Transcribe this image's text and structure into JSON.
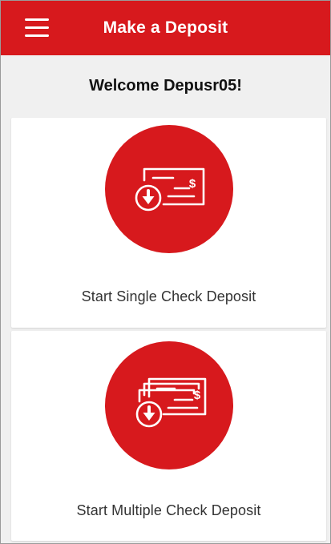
{
  "header": {
    "title": "Make a Deposit",
    "menu_icon": "hamburger-menu-icon"
  },
  "welcome": {
    "text": "Welcome Depusr05!"
  },
  "options": [
    {
      "label": "Start Single Check Deposit",
      "icon": "single-check-deposit-icon"
    },
    {
      "label": "Start Multiple Check Deposit",
      "icon": "multiple-check-deposit-icon"
    }
  ],
  "colors": {
    "brand_red": "#d7191d",
    "background": "#f0f0f0",
    "card": "#ffffff"
  }
}
